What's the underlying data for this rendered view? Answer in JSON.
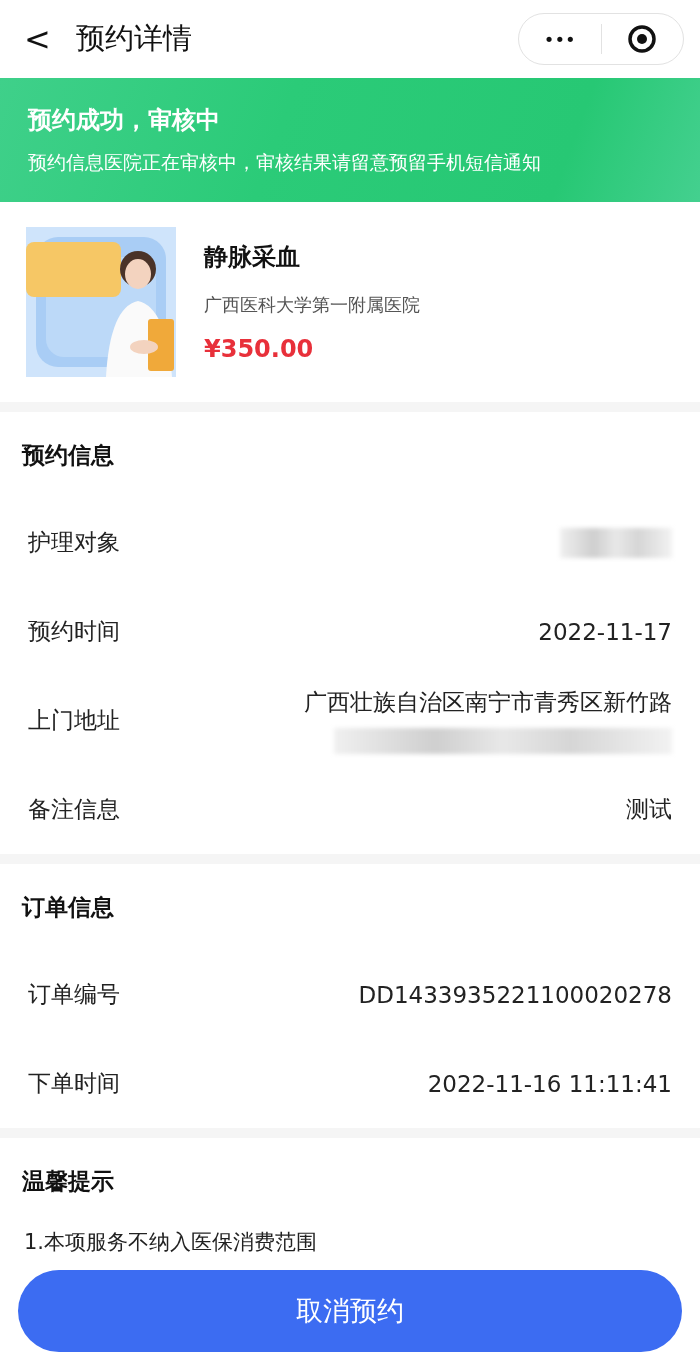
{
  "nav": {
    "back": "<",
    "title": "预约详情",
    "more": "•••"
  },
  "banner": {
    "title": "预约成功，审核中",
    "message": "预约信息医院正在审核中，审核结果请留意预留手机短信通知"
  },
  "product": {
    "name": "静脉采血",
    "hospital": "广西医科大学第一附属医院",
    "price": "¥350.00"
  },
  "sections": [
    {
      "title": "预约信息",
      "rows": [
        {
          "label": "护理对象",
          "kind": "redacted"
        },
        {
          "label": "预约时间",
          "kind": "text",
          "value": "2022-11-17"
        },
        {
          "label": "上门地址",
          "kind": "address",
          "value": "广西壮族自治区南宁市青秀区新竹路"
        },
        {
          "label": "备注信息",
          "kind": "text",
          "value": "测试"
        }
      ]
    },
    {
      "title": "订单信息",
      "rows": [
        {
          "label": "订单编号",
          "kind": "text",
          "value": "DD1433935221100020278"
        },
        {
          "label": "下单时间",
          "kind": "text",
          "value": "2022-11-16 11:11:41"
        }
      ]
    }
  ],
  "tips": {
    "title": "温馨提示",
    "items": [
      "1.本项服务不纳入医保消费范围"
    ]
  },
  "action": {
    "label": "取消预约"
  }
}
